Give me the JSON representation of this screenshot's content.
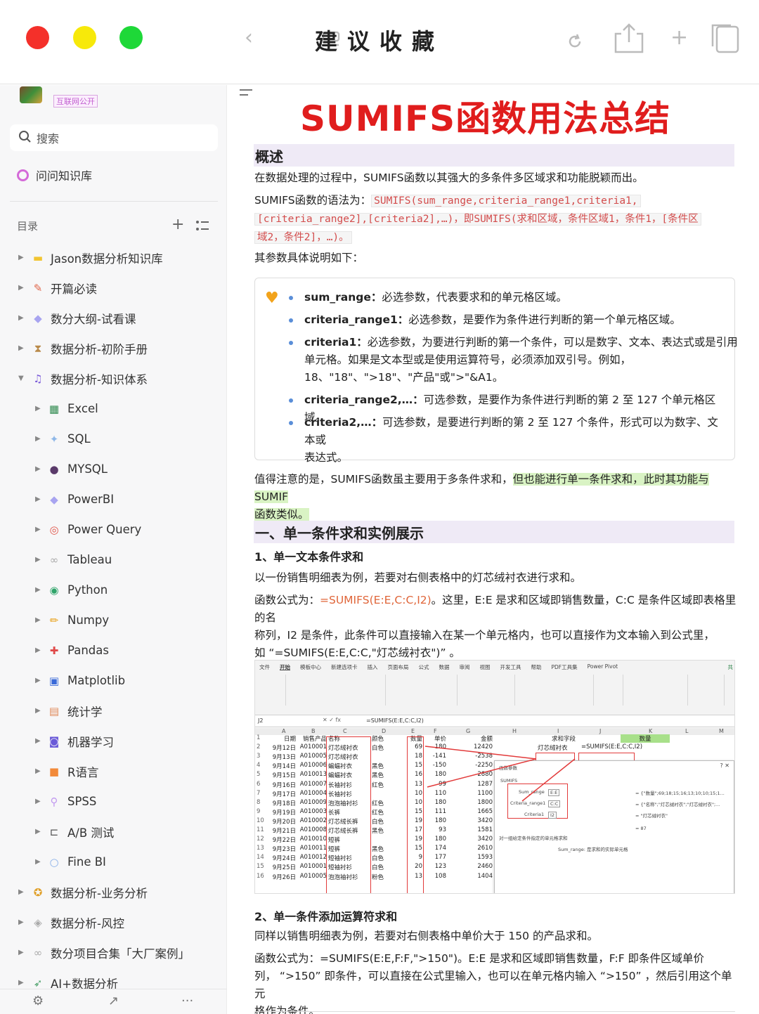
{
  "window": {
    "title": "建议收藏",
    "icons": [
      "back-icon",
      "layout-icon",
      "refresh-icon",
      "share-icon",
      "plus-icon",
      "copy-icon"
    ]
  },
  "sidebar": {
    "workspace_badge": "互联网公开",
    "search_label": "搜索",
    "ask_label": "问问知识库",
    "toc_label": "目录",
    "tree": [
      {
        "level": 1,
        "label": "Jason数据分析知识库",
        "icon": "folder-icon",
        "expanded": false
      },
      {
        "level": 1,
        "label": "开篇必读",
        "icon": "note-icon",
        "expanded": false
      },
      {
        "level": 1,
        "label": "数分大纲-试看课",
        "icon": "gem-icon",
        "expanded": false
      },
      {
        "level": 1,
        "label": "数据分析-初阶手册",
        "icon": "hourglass-icon",
        "expanded": false
      },
      {
        "level": 1,
        "label": "数据分析-知识体系",
        "icon": "music-icon",
        "expanded": true
      },
      {
        "level": 2,
        "label": "Excel",
        "icon": "excel-icon"
      },
      {
        "level": 2,
        "label": "SQL",
        "icon": "sparkle-icon"
      },
      {
        "level": 2,
        "label": "MYSQL",
        "icon": "globe-icon"
      },
      {
        "level": 2,
        "label": "PowerBI",
        "icon": "gem-icon"
      },
      {
        "level": 2,
        "label": "Power Query",
        "icon": "target-icon"
      },
      {
        "level": 2,
        "label": "Tableau",
        "icon": "link-icon"
      },
      {
        "level": 2,
        "label": "Python",
        "icon": "python-icon"
      },
      {
        "level": 2,
        "label": "Numpy",
        "icon": "pencil-icon"
      },
      {
        "level": 2,
        "label": "Pandas",
        "icon": "puzzle-icon"
      },
      {
        "level": 2,
        "label": "Matplotlib",
        "icon": "chart-icon"
      },
      {
        "level": 2,
        "label": "统计学",
        "icon": "book-icon"
      },
      {
        "level": 2,
        "label": "机器学习",
        "icon": "robot-icon"
      },
      {
        "level": 2,
        "label": "R语言",
        "icon": "r-icon"
      },
      {
        "level": 2,
        "label": "SPSS",
        "icon": "wand-icon"
      },
      {
        "level": 2,
        "label": "A/B 测试",
        "icon": "bracket-icon"
      },
      {
        "level": 2,
        "label": "Fine BI",
        "icon": "bubble-icon"
      },
      {
        "level": 1,
        "label": "数据分析-业务分析",
        "icon": "medal-icon",
        "expanded": false
      },
      {
        "level": 1,
        "label": "数据分析-风控",
        "icon": "shield-icon",
        "expanded": false
      },
      {
        "level": 1,
        "label": "数分项目合集「大厂案例」",
        "icon": "link-icon",
        "expanded": false
      },
      {
        "level": 1,
        "label": "AI+数据分析",
        "icon": "rocket-icon",
        "expanded": false
      }
    ],
    "bottom_icons": [
      "settings-icon",
      "share-arrow-icon",
      "more-icon"
    ]
  },
  "doc": {
    "title": "SUMIFS函数用法总结",
    "overview_heading": "概述",
    "p1": "在数据处理的过程中，SUMIFS函数以其强大的多条件多区域求和功能脱颖而出。",
    "syntax_prefix": "SUMIFS函数的语法为：",
    "syntax_code_1": "SUMIFS(sum_range,criteria_range1,criteria1,",
    "syntax_code_2": "[criteria_range2],[criteria2],…)，即SUMIFS(求和区域，条件区域1，条件1，[条件区",
    "syntax_code_3": "域2，条件2]，…)。",
    "params_intro": "其参数具体说明如下：",
    "params": [
      {
        "name": "sum_range：",
        "desc": "必选参数，代表要求和的单元格区域。"
      },
      {
        "name": "criteria_range1：",
        "desc": "必选参数，是要作为条件进行判断的第一个单元格区域。"
      },
      {
        "name": "criteria1：",
        "desc": "必选参数，为要进行判断的第一个条件，可以是数字、文本、表达式或是引用",
        "desc2": "单元格。如果是文本型或是使用运算符号，必须添加双引号。例如，",
        "desc3": "18、\"18\"、\">18\"、\"产品\"或\">\"&A1。"
      },
      {
        "name": "criteria_range2,…：",
        "desc": "可选参数，是要作为条件进行判断的第 2 至 127 个单元格区域。"
      },
      {
        "name": "criteria2,…：",
        "desc": "可选参数，是要进行判断的第 2 至 127 个条件，形式可以为数字、文本或",
        "desc2": "表达式。"
      }
    ],
    "note_a": "值得注意的是，SUMIFS函数虽主要用于多条件求和，",
    "note_b": "但也能进行单一条件求和，此时其功能与SUMIF",
    "note_c": "函数类似。",
    "section1_heading": "一、单一条件求和实例展示",
    "sub1_heading": "1、单一文本条件求和",
    "sub1_p1": "以一份销售明细表为例，若要对右侧表格中的灯芯绒衬衣进行求和。",
    "sub1_p2a": "函数公式为：",
    "sub1_p2_formula": "=SUMIFS(E:E,C:C,I2)",
    "sub1_p2b": "。这里，E:E 是求和区域即销售数量，C:C 是条件区域即表格里的名",
    "sub1_p2c": "称列，I2 是条件，此条件可以直接输入在某一个单元格内，也可以直接作为文本输入到公式里，",
    "sub1_p2d": "如 “=SUMIFS(E:E,C:C,\"灯芯绒衬衣\")” 。",
    "sub2_heading": "2、单一条件添加运算符求和",
    "sub2_p1": "同样以销售明细表为例，若要对右侧表格中单价大于 150 的产品求和。",
    "sub2_p2a": "函数公式为：=SUMIFS(E:E,F:F,\">150\")。E:E 是求和区域即销售数量，F:F 即条件区域单价",
    "sub2_p2b": "列，  “>150” 即条件，可以直接在公式里输入，也可以在单元格内输入 “>150” ，然后引用这个单元",
    "sub2_p2c": "格作为条件。"
  },
  "sheet": {
    "tabs": [
      "文件",
      "开始",
      "模板中心",
      "新建选项卡",
      "插入",
      "页面布局",
      "公式",
      "数据",
      "审阅",
      "视图",
      "开发工具",
      "帮助",
      "PDF工具集",
      "Power Pivot"
    ],
    "share": "共",
    "namebox": "J2",
    "formula": "=SUMIFS(E:E,C:C,I2)",
    "columns": [
      "A",
      "B",
      "C",
      "D",
      "E",
      "F",
      "G",
      "H",
      "I",
      "J",
      "K",
      "L",
      "M"
    ],
    "header": [
      "日期",
      "销售产品",
      "名称",
      "颜色",
      "数量",
      "单价",
      "金额"
    ],
    "rows": [
      [
        "9月12日",
        "A010001",
        "灯芯绒衬衣",
        "白色",
        "69",
        "180",
        "12420"
      ],
      [
        "9月13日",
        "A010005",
        "灯芯绒衬衣",
        "",
        "18",
        "-141",
        "-2538"
      ],
      [
        "9月14日",
        "A010006",
        "蝙蝠衬衣",
        "黑色",
        "15",
        "-150",
        "-2250"
      ],
      [
        "9月15日",
        "A010013",
        "蝙蝠衬衣",
        "黑色",
        "16",
        "180",
        "2880"
      ],
      [
        "9月16日",
        "A010007",
        "长袖衬衫",
        "红色",
        "13",
        "99",
        "1287"
      ],
      [
        "9月17日",
        "A010004",
        "长袖衬衫",
        "",
        "10",
        "110",
        "1100"
      ],
      [
        "9月18日",
        "A010009",
        "泡泡袖衬衫",
        "红色",
        "10",
        "180",
        "1800"
      ],
      [
        "9月19日",
        "A010003",
        "长裤",
        "红色",
        "15",
        "111",
        "1665"
      ],
      [
        "9月20日",
        "A010002",
        "灯芯绒长裤",
        "白色",
        "19",
        "180",
        "3420"
      ],
      [
        "9月21日",
        "A010008",
        "灯芯绒长裤",
        "黑色",
        "17",
        "93",
        "1581"
      ],
      [
        "9月22日",
        "A010010",
        "短裤",
        "",
        "19",
        "180",
        "3420"
      ],
      [
        "9月23日",
        "A010011",
        "短裤",
        "黑色",
        "15",
        "174",
        "2610"
      ],
      [
        "9月24日",
        "A010012",
        "短袖衬衫",
        "白色",
        "9",
        "177",
        "1593"
      ],
      [
        "9月25日",
        "A010001",
        "短袖衬衫",
        "白色",
        "20",
        "123",
        "2460"
      ],
      [
        "9月26日",
        "A010005",
        "泡泡袖衬衫",
        "粉色",
        "13",
        "108",
        "1404"
      ]
    ],
    "crit_header": "求和字段",
    "crit_value": "灯芯绒衬衣",
    "qty_header": "数量",
    "result_formula": "=SUMIFS(E:E,C:C,I2)",
    "dialog": {
      "title": "函数参数",
      "fn": "SUMIFS",
      "arg1_label": "Sum_range",
      "arg1_value": "E:E",
      "arg2_label": "Criteria_range1",
      "arg2_value": "C:C",
      "arg3_label": "Criteria1",
      "arg3_value": "I2",
      "arg1_result": "= {\"数量\";69;18;15;16;13;10;10;15;1...",
      "arg2_result": "= {\"名称\";\"灯芯绒衬衣\";\"灯芯绒衬衣\";...",
      "arg3_result": "= \"灯芯绒衬衣\"",
      "total": "= 87",
      "desc": "对一组给定条件指定的单元格求和",
      "desc2": "Sum_range: 是求和的实际单元格"
    }
  }
}
